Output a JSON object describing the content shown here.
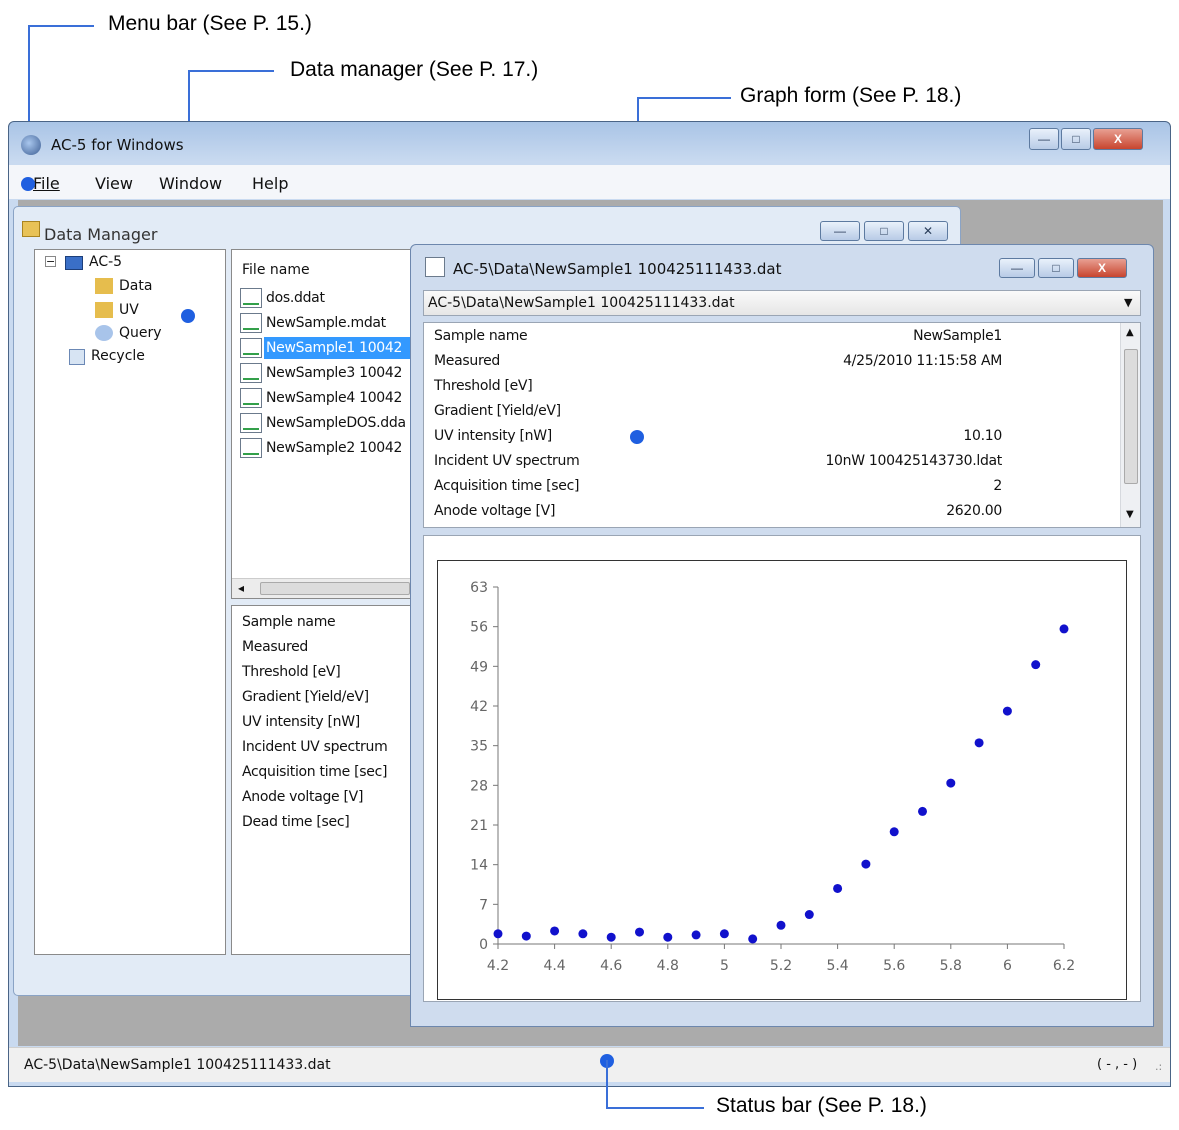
{
  "annotations": {
    "menu_bar": "Menu bar (See P. 15.)",
    "data_manager": "Data manager (See P. 17.)",
    "graph_form": "Graph form (See P. 18.)",
    "status_bar": "Status bar (See P. 18.)"
  },
  "window": {
    "title": "AC-5 for Windows",
    "controls": {
      "minimize": "—",
      "maximize": "□",
      "close": "X"
    }
  },
  "menubar": [
    "File",
    "View",
    "Window",
    "Help"
  ],
  "data_manager": {
    "title": "Data Manager",
    "tree": {
      "root": "AC-5",
      "children": [
        "Data",
        "UV",
        "Query"
      ],
      "recycle": "Recycle"
    },
    "file_list": {
      "header": "File name",
      "items": [
        "dos.ddat",
        "NewSample.mdat",
        "NewSample1 10042",
        "NewSample3 10042",
        "NewSample4 10042",
        "NewSampleDOS.dda",
        "NewSample2 10042"
      ],
      "selected_index": 2
    },
    "info_labels": [
      "Sample name",
      "Measured",
      "Threshold [eV]",
      "Gradient [Yield/eV]",
      "UV intensity [nW]",
      "Incident UV spectrum",
      "Acquisition time [sec]",
      "Anode voltage [V]",
      "Dead time [sec]"
    ]
  },
  "graph_form": {
    "title": "AC-5\\Data\\NewSample1 100425111433.dat",
    "combo_value": "AC-5\\Data\\NewSample1 100425111433.dat",
    "info": [
      {
        "label": "Sample name",
        "value": "NewSample1"
      },
      {
        "label": "Measured",
        "value": "4/25/2010 11:15:58 AM"
      },
      {
        "label": "Threshold [eV]",
        "value": ""
      },
      {
        "label": "Gradient [Yield/eV]",
        "value": ""
      },
      {
        "label": "UV intensity [nW]",
        "value": "10.10"
      },
      {
        "label": "Incident UV spectrum",
        "value": "10nW 100425143730.ldat"
      },
      {
        "label": "Acquisition time [sec]",
        "value": "2"
      },
      {
        "label": "Anode voltage [V]",
        "value": "2620.00"
      }
    ]
  },
  "status": {
    "path": "AC-5\\Data\\NewSample1 100425111433.dat",
    "coords": "( - , - )"
  },
  "chart_data": {
    "type": "scatter",
    "title": "",
    "xlabel": "",
    "ylabel": "",
    "xlim": [
      4.2,
      6.2
    ],
    "ylim": [
      0,
      63
    ],
    "xticks": [
      "4.2",
      "4.4",
      "4.6",
      "4.8",
      "5",
      "5.2",
      "5.4",
      "5.6",
      "5.8",
      "6",
      "6.2"
    ],
    "yticks": [
      "0",
      "7",
      "14",
      "21",
      "28",
      "35",
      "42",
      "49",
      "56",
      "63"
    ],
    "color": "#1111cc",
    "x": [
      4.2,
      4.3,
      4.4,
      4.5,
      4.6,
      4.7,
      4.8,
      4.9,
      5.0,
      5.1,
      5.2,
      5.3,
      5.4,
      5.5,
      5.6,
      5.7,
      5.8,
      5.9,
      6.0,
      6.1,
      6.2
    ],
    "y": [
      1.8,
      1.4,
      2.3,
      1.8,
      1.2,
      2.1,
      1.2,
      1.6,
      1.8,
      0.9,
      3.3,
      5.2,
      9.8,
      14.1,
      19.8,
      23.4,
      28.4,
      35.5,
      41.1,
      49.3,
      55.6
    ]
  }
}
